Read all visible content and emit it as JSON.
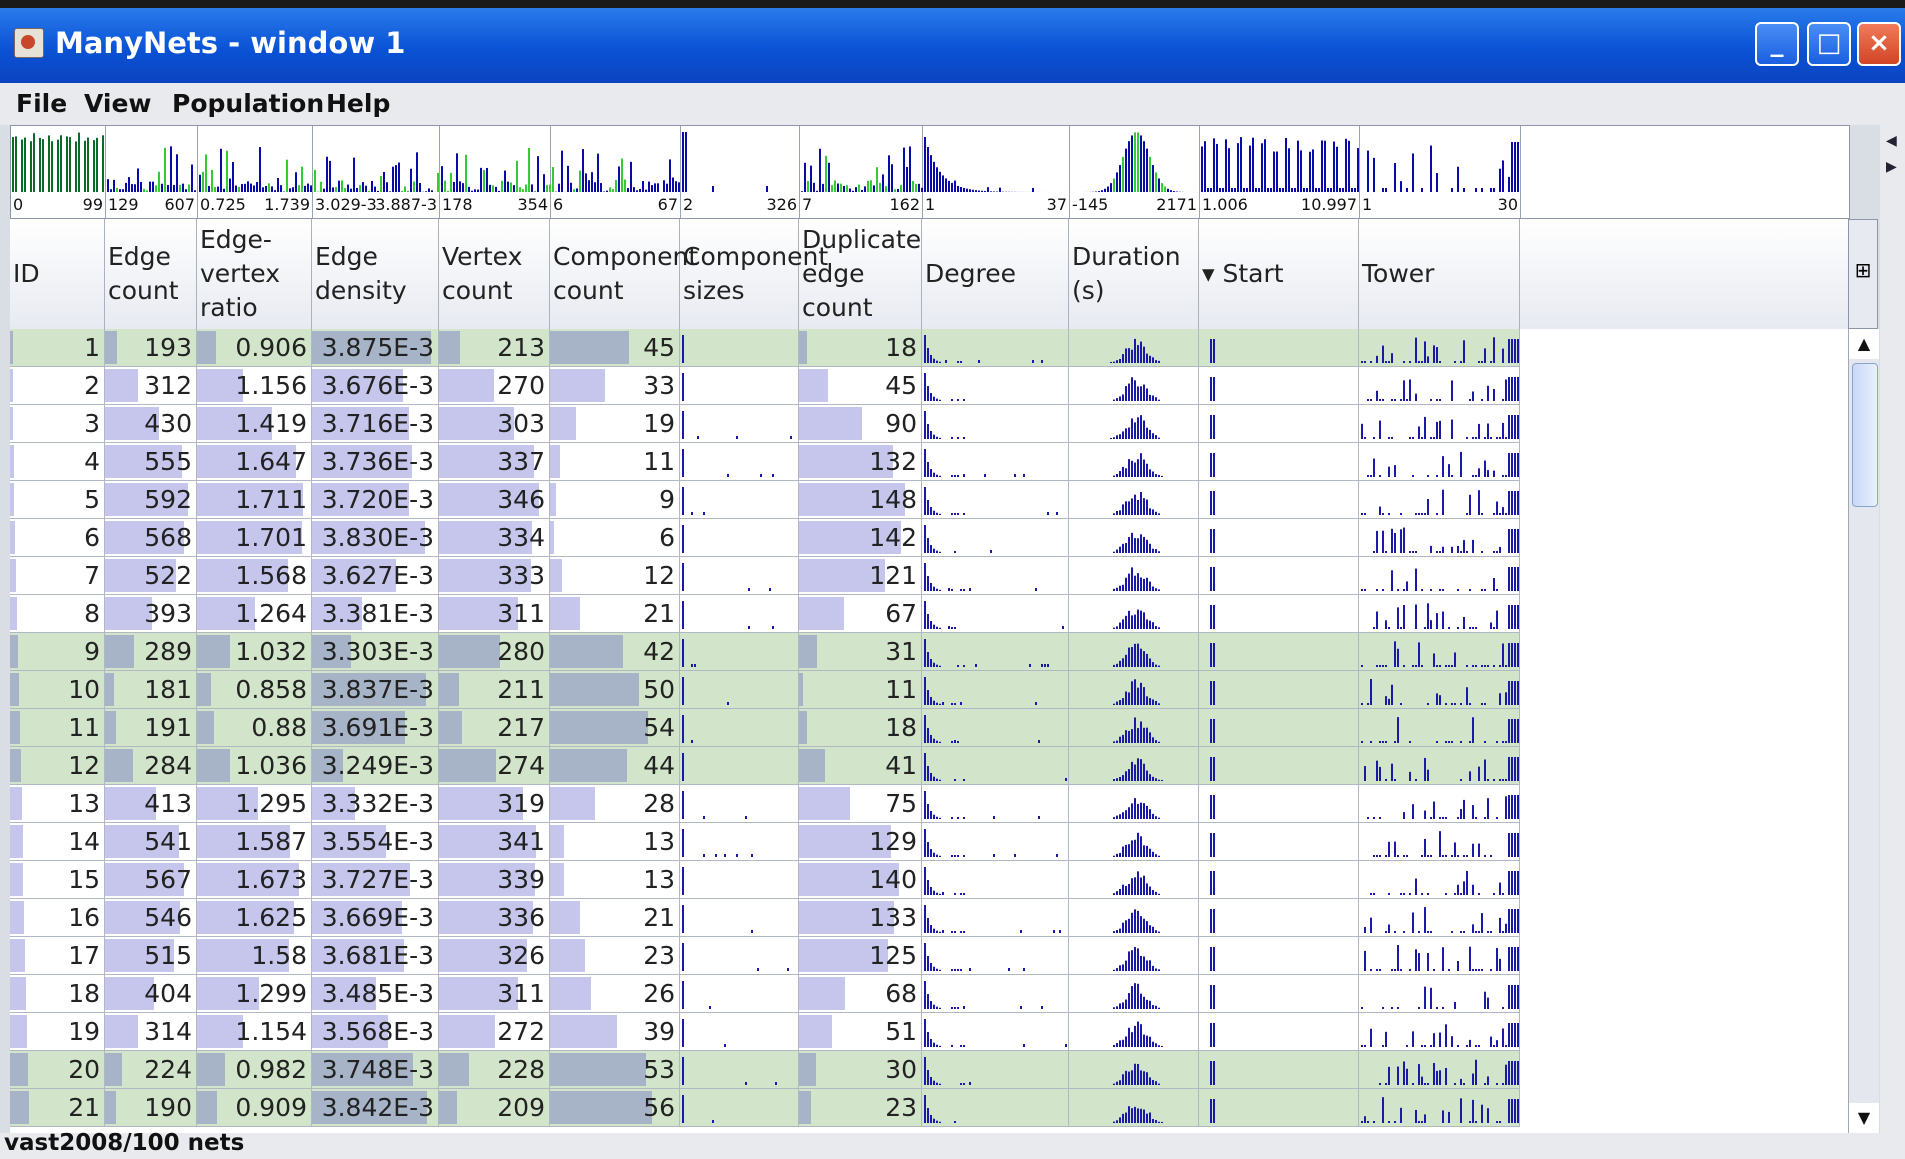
{
  "window": {
    "title": "ManyNets - window 1",
    "minimize": "_",
    "maximize": "□",
    "close": "×"
  },
  "menu": [
    "File",
    "View",
    "Population",
    "Help"
  ],
  "summary_ranges": [
    {
      "min": "0",
      "max": "99"
    },
    {
      "min": "129",
      "max": "607"
    },
    {
      "min": "0.725",
      "max": "1.739"
    },
    {
      "min": "3.029-3",
      "max": "3.887-3"
    },
    {
      "min": "178",
      "max": "354"
    },
    {
      "min": "6",
      "max": "67"
    },
    {
      "min": "2",
      "max": "326"
    },
    {
      "min": "7",
      "max": "162"
    },
    {
      "min": "1",
      "max": "37"
    },
    {
      "min": "-145",
      "max": "2171"
    },
    {
      "min": "1.006",
      "max": "10.997"
    },
    {
      "min": "1",
      "max": "30"
    }
  ],
  "columns": [
    "ID",
    "Edge\ncount",
    "Edge-vertex\nratio",
    "Edge\ndensity",
    "Vertex\ncount",
    "Component\ncount",
    "Component\nsizes",
    "Duplicate\nedge\ncount",
    "Degree",
    "Duration\n(s)",
    "▾ Start",
    "Tower"
  ],
  "colors": {
    "row_green": "#d2e5ca",
    "row_white": "#ffffff",
    "bar_fill": "#c6c6ec",
    "bar_grey": "#a7b3c6",
    "spark_blue": "#1a1aa6",
    "hist_green": "#33cc33",
    "hist_blue": "#0a0aa8"
  },
  "rows": [
    {
      "id": "1",
      "edge_count": "193",
      "ev_ratio": "0.906",
      "edge_density": "3.875E-3",
      "vertex_count": "213",
      "comp_count": "45",
      "dup_edge": "18",
      "selected": true
    },
    {
      "id": "2",
      "edge_count": "312",
      "ev_ratio": "1.156",
      "edge_density": "3.676E-3",
      "vertex_count": "270",
      "comp_count": "33",
      "dup_edge": "45",
      "selected": false
    },
    {
      "id": "3",
      "edge_count": "430",
      "ev_ratio": "1.419",
      "edge_density": "3.716E-3",
      "vertex_count": "303",
      "comp_count": "19",
      "dup_edge": "90",
      "selected": false
    },
    {
      "id": "4",
      "edge_count": "555",
      "ev_ratio": "1.647",
      "edge_density": "3.736E-3",
      "vertex_count": "337",
      "comp_count": "11",
      "dup_edge": "132",
      "selected": false
    },
    {
      "id": "5",
      "edge_count": "592",
      "ev_ratio": "1.711",
      "edge_density": "3.720E-3",
      "vertex_count": "346",
      "comp_count": "9",
      "dup_edge": "148",
      "selected": false
    },
    {
      "id": "6",
      "edge_count": "568",
      "ev_ratio": "1.701",
      "edge_density": "3.830E-3",
      "vertex_count": "334",
      "comp_count": "6",
      "dup_edge": "142",
      "selected": false
    },
    {
      "id": "7",
      "edge_count": "522",
      "ev_ratio": "1.568",
      "edge_density": "3.627E-3",
      "vertex_count": "333",
      "comp_count": "12",
      "dup_edge": "121",
      "selected": false
    },
    {
      "id": "8",
      "edge_count": "393",
      "ev_ratio": "1.264",
      "edge_density": "3.381E-3",
      "vertex_count": "311",
      "comp_count": "21",
      "dup_edge": "67",
      "selected": false
    },
    {
      "id": "9",
      "edge_count": "289",
      "ev_ratio": "1.032",
      "edge_density": "3.303E-3",
      "vertex_count": "280",
      "comp_count": "42",
      "dup_edge": "31",
      "selected": true
    },
    {
      "id": "10",
      "edge_count": "181",
      "ev_ratio": "0.858",
      "edge_density": "3.837E-3",
      "vertex_count": "211",
      "comp_count": "50",
      "dup_edge": "11",
      "selected": true
    },
    {
      "id": "11",
      "edge_count": "191",
      "ev_ratio": "0.88",
      "edge_density": "3.691E-3",
      "vertex_count": "217",
      "comp_count": "54",
      "dup_edge": "18",
      "selected": true
    },
    {
      "id": "12",
      "edge_count": "284",
      "ev_ratio": "1.036",
      "edge_density": "3.249E-3",
      "vertex_count": "274",
      "comp_count": "44",
      "dup_edge": "41",
      "selected": true
    },
    {
      "id": "13",
      "edge_count": "413",
      "ev_ratio": "1.295",
      "edge_density": "3.332E-3",
      "vertex_count": "319",
      "comp_count": "28",
      "dup_edge": "75",
      "selected": false
    },
    {
      "id": "14",
      "edge_count": "541",
      "ev_ratio": "1.587",
      "edge_density": "3.554E-3",
      "vertex_count": "341",
      "comp_count": "13",
      "dup_edge": "129",
      "selected": false
    },
    {
      "id": "15",
      "edge_count": "567",
      "ev_ratio": "1.673",
      "edge_density": "3.727E-3",
      "vertex_count": "339",
      "comp_count": "13",
      "dup_edge": "140",
      "selected": false
    },
    {
      "id": "16",
      "edge_count": "546",
      "ev_ratio": "1.625",
      "edge_density": "3.669E-3",
      "vertex_count": "336",
      "comp_count": "21",
      "dup_edge": "133",
      "selected": false
    },
    {
      "id": "17",
      "edge_count": "515",
      "ev_ratio": "1.58",
      "edge_density": "3.681E-3",
      "vertex_count": "326",
      "comp_count": "23",
      "dup_edge": "125",
      "selected": false
    },
    {
      "id": "18",
      "edge_count": "404",
      "ev_ratio": "1.299",
      "edge_density": "3.485E-3",
      "vertex_count": "311",
      "comp_count": "26",
      "dup_edge": "68",
      "selected": false
    },
    {
      "id": "19",
      "edge_count": "314",
      "ev_ratio": "1.154",
      "edge_density": "3.568E-3",
      "vertex_count": "272",
      "comp_count": "39",
      "dup_edge": "51",
      "selected": false
    },
    {
      "id": "20",
      "edge_count": "224",
      "ev_ratio": "0.982",
      "edge_density": "3.748E-3",
      "vertex_count": "228",
      "comp_count": "53",
      "dup_edge": "30",
      "selected": true
    },
    {
      "id": "21",
      "edge_count": "190",
      "ev_ratio": "0.909",
      "edge_density": "3.842E-3",
      "vertex_count": "209",
      "comp_count": "56",
      "dup_edge": "23",
      "selected": true
    }
  ],
  "status": "vast2008/100 nets"
}
